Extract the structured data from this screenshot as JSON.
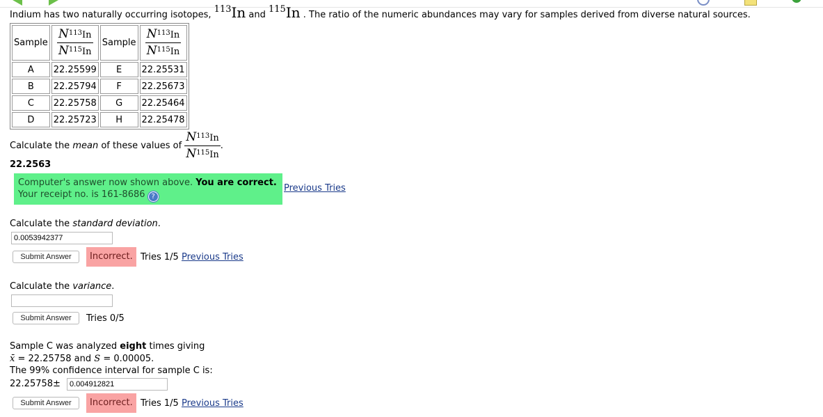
{
  "intro": {
    "text_before": "Indium has two naturally occurring isotopes, ",
    "iso1_mass": "113",
    "element": "In",
    "joiner": " and ",
    "iso2_mass": "115",
    "text_after": ". The ratio of the numeric abundances may vary for samples derived from diverse natural sources."
  },
  "table": {
    "header_sample": "Sample",
    "ratio": {
      "symbol": "N",
      "num_mass": "113",
      "den_mass": "115",
      "element": "In"
    },
    "rows": [
      {
        "s1": "A",
        "v1": "22.25599",
        "s2": "E",
        "v2": "22.25531"
      },
      {
        "s1": "B",
        "v1": "22.25794",
        "s2": "F",
        "v2": "22.25673"
      },
      {
        "s1": "C",
        "v1": "22.25758",
        "s2": "G",
        "v2": "22.25464"
      },
      {
        "s1": "D",
        "v1": "22.25723",
        "s2": "H",
        "v2": "22.25478"
      }
    ]
  },
  "q_mean": {
    "text_before": "Calculate the ",
    "emph": "mean",
    "text_after": " of these values of ",
    "trailing": "."
  },
  "mean_answer": "22.2563",
  "correct_box": {
    "line1": "Computer's answer now shown above. ",
    "line1_bold": "You are correct.",
    "line2": "Your receipt no. is 161-8686 ",
    "help_glyph": "?"
  },
  "previous_tries_label": "Previous Tries",
  "q_sd": {
    "text_before": "Calculate the ",
    "emph": "standard deviation",
    "text_after": "."
  },
  "sd_input_value": "0.0053942377",
  "submit_label": "Submit Answer",
  "incorrect_label": "Incorrect.",
  "tries_sd": "Tries 1/5",
  "q_var": {
    "text_before": "Calculate the ",
    "emph": "variance",
    "text_after": "."
  },
  "var_input_value": "",
  "tries_var": "Tries 0/5",
  "sample_c": {
    "line1_before": "Sample C was analyzed ",
    "line1_bold": "eight",
    "line1_after": " times giving",
    "xbar": "x̄",
    "eq": " = ",
    "xbar_value": "22.25758",
    "and": " and ",
    "s_symbol": "S",
    "s_value": "0.00005.",
    "line3": "The 99% confidence interval for sample C is:"
  },
  "ci_prefix": "22.25758±",
  "ci_input_value": "0.004912821",
  "tries_ci": "Tries 1/5",
  "colors": {
    "correct_bg": "#5ff08a",
    "incorrect_bg": "#f9a3a3",
    "link": "#1a3a8a",
    "nav_arrow": "#6cc04a"
  },
  "icons": [
    "back-arrow-icon",
    "forward-arrow-icon",
    "help-icon"
  ]
}
